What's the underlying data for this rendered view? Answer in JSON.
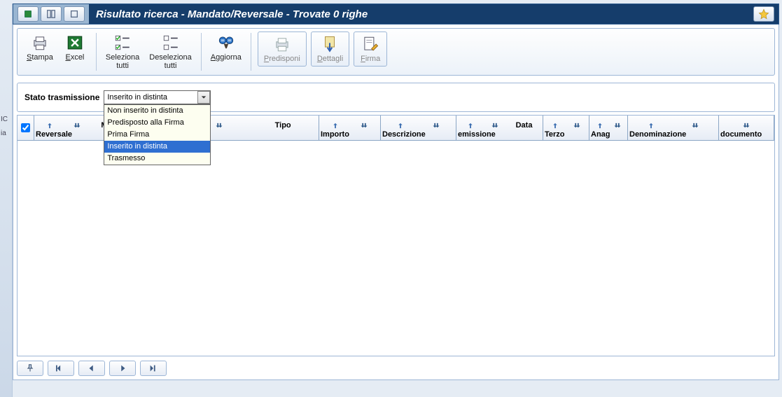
{
  "title": "Risultato ricerca - Mandato/Reversale - Trovate 0 righe",
  "side": {
    "t1": "IC",
    "t2": "ia"
  },
  "toolbar": {
    "stampa": "Stampa",
    "excel": "Excel",
    "seleziona": "Seleziona\ntutti",
    "deseleziona": "Deseleziona\ntutti",
    "aggiorna": "Aggiorna",
    "predisponi": "Predisponi",
    "dettagli": "Dettagli",
    "firma": "Firma"
  },
  "filter": {
    "label": "Stato trasmissione",
    "selected": "Inserito in distinta",
    "options": [
      "Non inserito in distinta",
      "Predisposto alla Firma",
      "Prima Firma",
      "Inserito in distinta",
      "Trasmesso"
    ]
  },
  "columns": {
    "c0": "Reversale",
    "c0top": "Man",
    "c1": "documento",
    "c1top": "Tipo",
    "c2": "Importo",
    "c3": "Descrizione",
    "c4": "emissione",
    "c4top": "Data",
    "c5": "Terzo",
    "c6": "Anag",
    "c7": "Denominazione",
    "c8": "documento"
  }
}
